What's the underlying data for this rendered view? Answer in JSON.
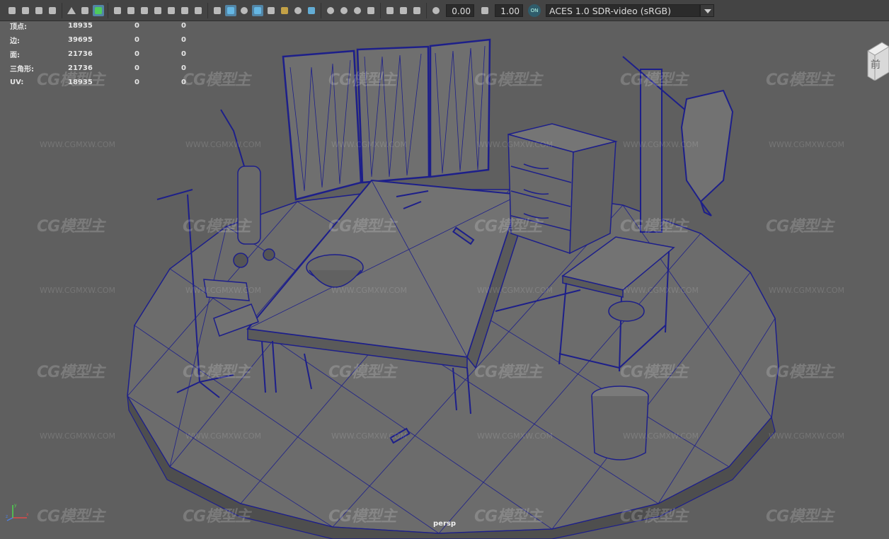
{
  "colors": {
    "viewport_bg": "#5f5f5f",
    "wireframe": "#1d1f8a",
    "mesh_fill": "#6f6f6f",
    "accent": "#5285a6"
  },
  "toolbar": {
    "icons": [
      "camera-icon",
      "camera-attributes-icon",
      "image-plane-icon",
      "bookmark-icon",
      "grease-pencil-icon",
      "2d-pan-zoom-icon",
      "grease-pencil-tool-icon",
      "grid-icon",
      "film-gate-icon",
      "resolution-gate-icon",
      "gate-mask-icon",
      "field-chart-icon",
      "safe-action-icon",
      "safe-title-icon",
      "wireframe-icon",
      "smooth-shade-icon",
      "default-material-icon",
      "wireframe-on-shaded-icon",
      "textured-icon",
      "use-all-lights-icon",
      "shadows-icon",
      "screen-space-ao-icon",
      "motion-blur-icon",
      "multisample-aa-icon",
      "depth-of-field-icon",
      "isolate-select-icon",
      "xray-icon",
      "xray-joints-icon",
      "backface-culling-icon",
      "exposure-icon",
      "gamma-icon",
      "color-management-icon"
    ],
    "exposure_value": "0.00",
    "gamma_value": "1.00",
    "color_management_badge": "ON",
    "color_space": "ACES 1.0 SDR-video (sRGB)"
  },
  "hud": {
    "rows": [
      {
        "label": "顶点:",
        "v1": "18935",
        "v2": "0",
        "v3": "0"
      },
      {
        "label": "边:",
        "v1": "39695",
        "v2": "0",
        "v3": "0"
      },
      {
        "label": "面:",
        "v1": "21736",
        "v2": "0",
        "v3": "0"
      },
      {
        "label": "三角形:",
        "v1": "21736",
        "v2": "0",
        "v3": "0"
      },
      {
        "label": "UV:",
        "v1": "18935",
        "v2": "0",
        "v3": "0"
      }
    ]
  },
  "viewport": {
    "camera_label": "persp",
    "viewcube_face": "前",
    "axis_labels": {
      "x": "x",
      "y": "y",
      "z": "z"
    }
  },
  "watermark": {
    "logo": "CG模型主",
    "url": "WWW.CGMXW.COM"
  }
}
